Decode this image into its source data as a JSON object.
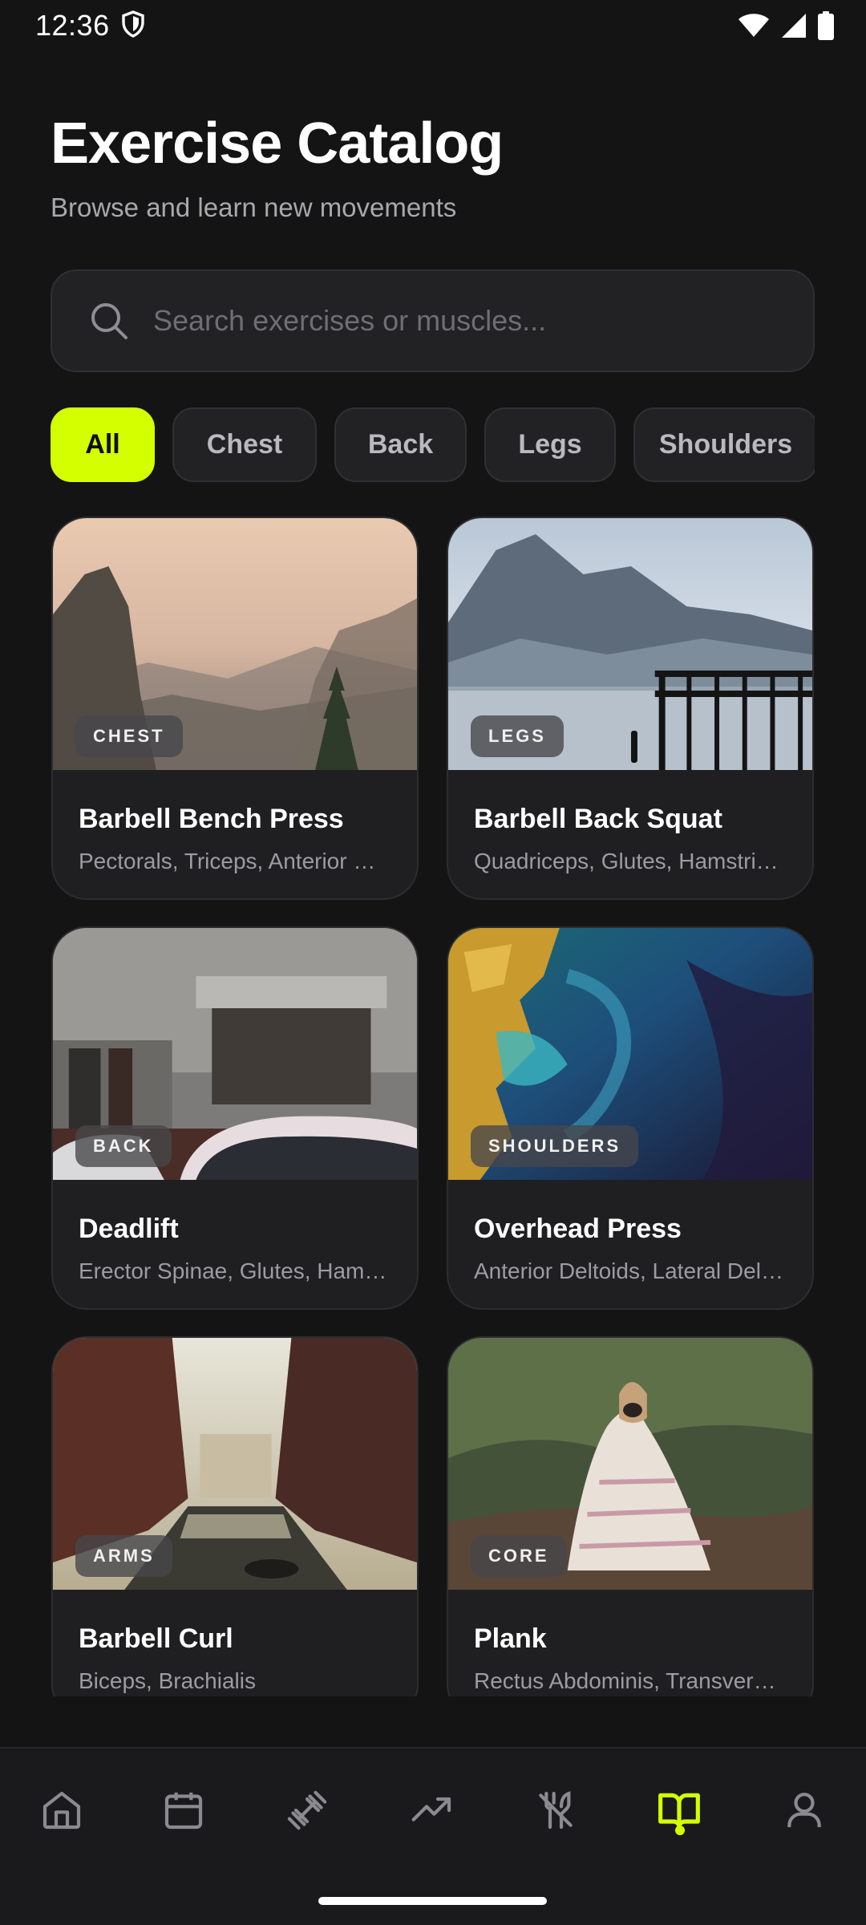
{
  "status_bar": {
    "time": "12:36",
    "left_icon": "shield-icon",
    "right_icons": [
      "wifi-icon",
      "signal-icon",
      "battery-icon"
    ]
  },
  "header": {
    "title": "Exercise Catalog",
    "subtitle": "Browse and learn new movements"
  },
  "search": {
    "placeholder": "Search exercises or muscles...",
    "value": "",
    "icon": "search-icon"
  },
  "filters": [
    {
      "label": "All",
      "active": true
    },
    {
      "label": "Chest",
      "active": false
    },
    {
      "label": "Back",
      "active": false
    },
    {
      "label": "Legs",
      "active": false
    },
    {
      "label": "Shoulders",
      "active": false
    }
  ],
  "exercises": [
    {
      "category": "CHEST",
      "name": "Barbell Bench Press",
      "muscles": "Pectorals, Triceps, Anterior Deltoids"
    },
    {
      "category": "LEGS",
      "name": "Barbell Back Squat",
      "muscles": "Quadriceps, Glutes, Hamstrings"
    },
    {
      "category": "BACK",
      "name": "Deadlift",
      "muscles": "Erector Spinae, Glutes, Hamstrings"
    },
    {
      "category": "SHOULDERS",
      "name": "Overhead Press",
      "muscles": "Anterior Deltoids, Lateral Deltoids"
    },
    {
      "category": "ARMS",
      "name": "Barbell Curl",
      "muscles": "Biceps, Brachialis"
    },
    {
      "category": "CORE",
      "name": "Plank",
      "muscles": "Rectus Abdominis, Transverse Abdominis"
    }
  ],
  "bottom_nav": {
    "items": [
      "home-icon",
      "calendar-icon",
      "dumbbell-icon",
      "trending-up-icon",
      "utensils-off-icon",
      "book-open-icon",
      "user-icon"
    ],
    "active_index": 5
  },
  "colors": {
    "accent": "#d4ff00",
    "background": "#141414",
    "surface": "#1f1f21"
  }
}
